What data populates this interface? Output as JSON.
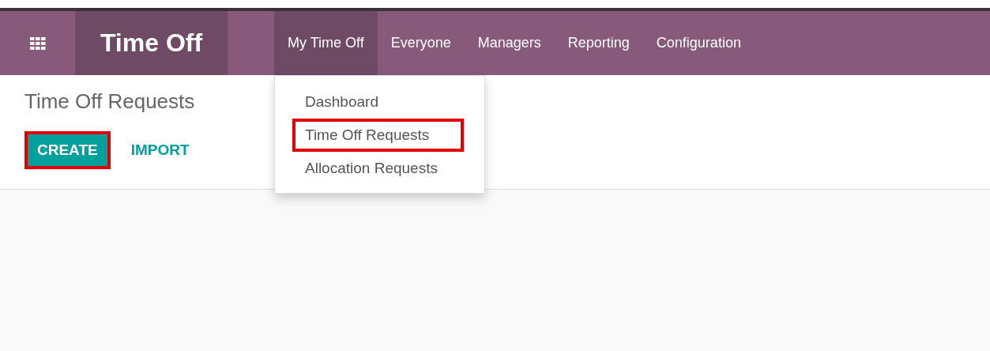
{
  "app": {
    "title": "Time Off"
  },
  "menu": [
    {
      "label": "My Time Off",
      "selected": true
    },
    {
      "label": "Everyone",
      "selected": false
    },
    {
      "label": "Managers",
      "selected": false
    },
    {
      "label": "Reporting",
      "selected": false
    },
    {
      "label": "Configuration",
      "selected": false
    }
  ],
  "dropdown": [
    {
      "label": "Dashboard",
      "highlighted": false
    },
    {
      "label": "Time Off Requests",
      "highlighted": true
    },
    {
      "label": "Allocation Requests",
      "highlighted": false
    }
  ],
  "page": {
    "title": "Time Off Requests"
  },
  "buttons": [
    {
      "label": "CREATE",
      "kind": "primary",
      "highlighted": true
    },
    {
      "label": "IMPORT",
      "kind": "link",
      "highlighted": false
    }
  ]
}
